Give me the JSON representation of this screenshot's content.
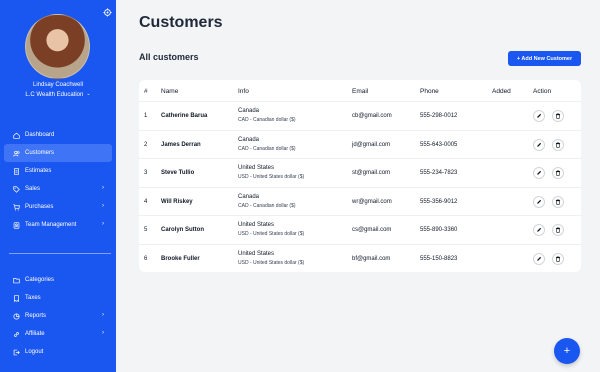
{
  "user": {
    "name": "Lindsay Coachwell",
    "company": "L.C Wealth Education"
  },
  "nav_top": [
    {
      "label": "Dashboard",
      "icon": "home-icon"
    },
    {
      "label": "Customers",
      "icon": "users-icon",
      "active": true
    },
    {
      "label": "Estimates",
      "icon": "document-icon"
    },
    {
      "label": "Sales",
      "icon": "tag-icon",
      "chevron": true
    },
    {
      "label": "Purchases",
      "icon": "cart-icon",
      "chevron": true
    },
    {
      "label": "Team Management",
      "icon": "team-icon",
      "chevron": true
    }
  ],
  "nav_bottom": [
    {
      "label": "Categories",
      "icon": "folder-icon"
    },
    {
      "label": "Taxes",
      "icon": "receipt-icon"
    },
    {
      "label": "Reports",
      "icon": "chart-icon",
      "chevron": true
    },
    {
      "label": "Affiliate",
      "icon": "link-icon",
      "chevron": true
    },
    {
      "label": "Logout",
      "icon": "logout-icon"
    }
  ],
  "page": {
    "title": "Customers",
    "section_title": "All customers",
    "add_button": "+ Add New Customer"
  },
  "table": {
    "headers": [
      "#",
      "Name",
      "Info",
      "Email",
      "Phone",
      "Added",
      "Action"
    ],
    "rows": [
      {
        "num": "1",
        "name": "Catherine Barua",
        "country": "Canada",
        "currency": "CAD - Canadian dollar ($)",
        "email": "cb@gmail.com",
        "phone": "555-298-0012"
      },
      {
        "num": "2",
        "name": "James Derran",
        "country": "Canada",
        "currency": "CAD - Canadian dollar ($)",
        "email": "jd@gmail.com",
        "phone": "555-643-0005"
      },
      {
        "num": "3",
        "name": "Steve Tullio",
        "country": "United States",
        "currency": "USD - United States dollar ($)",
        "email": "st@gmail.com",
        "phone": "555-234-7823"
      },
      {
        "num": "4",
        "name": "Will Riskey",
        "country": "Canada",
        "currency": "CAD - Canadian dollar ($)",
        "email": "wr@gmail.com",
        "phone": "555-356-9012"
      },
      {
        "num": "5",
        "name": "Carolyn Sutton",
        "country": "United States",
        "currency": "USD - United States dollar ($)",
        "email": "cs@gmail.com",
        "phone": "555-890-3360"
      },
      {
        "num": "6",
        "name": "Brooke Fuller",
        "country": "United States",
        "currency": "USD - United States dollar ($)",
        "email": "bf@gmail.com",
        "phone": "555-150-8823"
      }
    ]
  },
  "fab": {
    "label": "+"
  },
  "colors": {
    "primary": "#1a56f0",
    "active_nav": "#3f74f6",
    "background": "#f3f4f6"
  }
}
